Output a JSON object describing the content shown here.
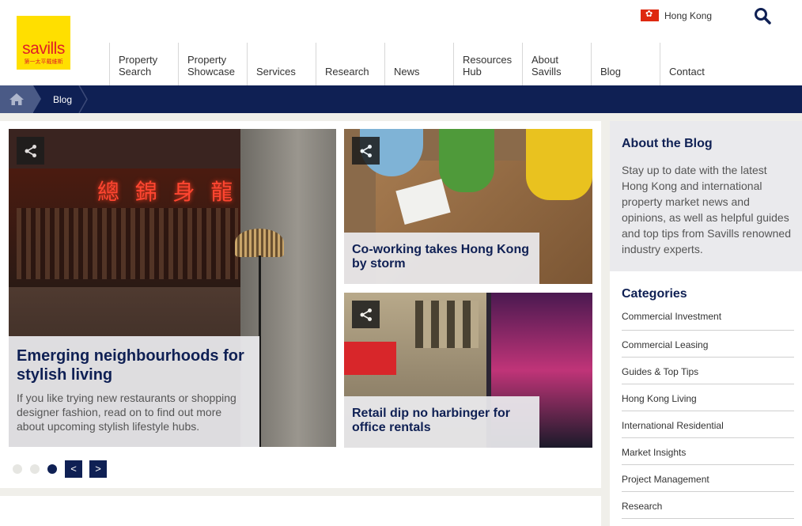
{
  "logo": {
    "brand": "savills",
    "tagline_cn": "第一太平戴維斯"
  },
  "locale": {
    "label": "Hong Kong"
  },
  "nav": [
    {
      "l1": "Property",
      "l2": "Search"
    },
    {
      "l1": "Property",
      "l2": "Showcase"
    },
    {
      "l1": "Services",
      "l2": ""
    },
    {
      "l1": "Research",
      "l2": ""
    },
    {
      "l1": "News",
      "l2": ""
    },
    {
      "l1": "Resources",
      "l2": "Hub"
    },
    {
      "l1": "About",
      "l2": "Savills"
    },
    {
      "l1": "Blog",
      "l2": ""
    },
    {
      "l1": "Contact",
      "l2": ""
    }
  ],
  "breadcrumb": {
    "current": "Blog"
  },
  "featured": [
    {
      "title": "Emerging neighbourhoods for stylish living",
      "excerpt": "If you like trying new restaurants or shopping designer fashion, read on to find out more about upcoming stylish lifestyle hubs.",
      "neon_text": "總 錦 身 龍"
    },
    {
      "title": "Co-working takes Hong Kong by storm"
    },
    {
      "title": "Retail dip no harbinger for office rentals"
    }
  ],
  "carousel": {
    "prev": "<",
    "next": ">",
    "count": 3,
    "active": 3
  },
  "about": {
    "title": "About the Blog",
    "text": "Stay up to date with the latest Hong Kong and international property market news and opinions, as well as helpful guides and top tips from Savills renowned industry experts."
  },
  "categories": {
    "title": "Categories",
    "items": [
      "Commercial Investment",
      "Commercial Leasing",
      "Guides & Top Tips",
      "Hong Kong Living",
      "International Residential",
      "Market Insights",
      "Project Management",
      "Research"
    ]
  },
  "colors": {
    "navy": "#0f2054",
    "brand_yellow": "#ffdf00",
    "brand_red": "#e01f26"
  }
}
